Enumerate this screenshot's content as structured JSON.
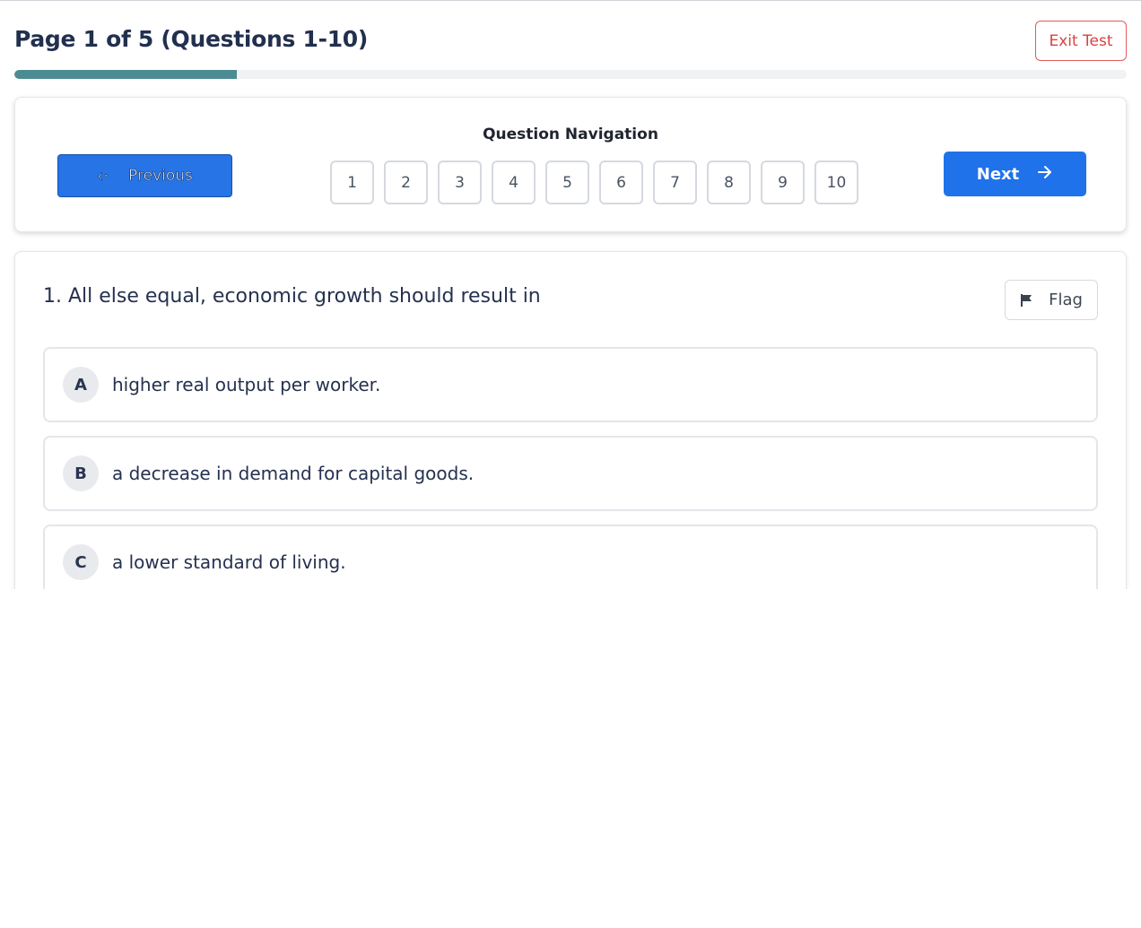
{
  "header": {
    "title": "Page 1 of 5 (Questions 1-10)",
    "exit_label": "Exit Test",
    "progress_fraction": 0.2,
    "progress_color": "#4a8c91"
  },
  "navigation": {
    "title": "Question Navigation",
    "previous_label": "Previous",
    "next_label": "Next",
    "numbers": [
      "1",
      "2",
      "3",
      "4",
      "5",
      "6",
      "7",
      "8",
      "9",
      "10"
    ],
    "accent_color": "#1f72ea"
  },
  "question": {
    "text": "1. All else equal, economic growth should result in",
    "flag_label": "Flag",
    "options": [
      {
        "letter": "A",
        "text": "higher real output per worker."
      },
      {
        "letter": "B",
        "text": "a decrease in demand for capital goods."
      },
      {
        "letter": "C",
        "text": "a lower standard of living."
      }
    ]
  },
  "icons": {
    "previous": "arrow-left-icon",
    "next": "arrow-right-icon",
    "flag": "flag-icon"
  }
}
